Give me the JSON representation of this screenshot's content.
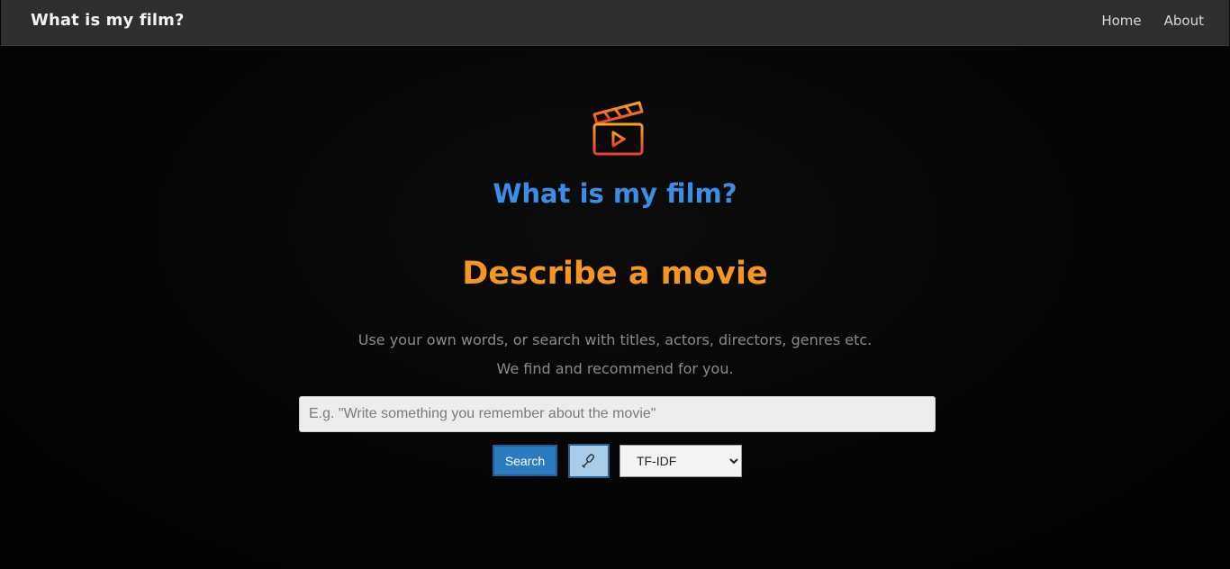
{
  "navbar": {
    "brand": "What is my film?",
    "links": [
      {
        "label": "Home"
      },
      {
        "label": "About"
      }
    ]
  },
  "hero": {
    "logo_icon": "clapperboard-play-icon",
    "title": "What is my film?",
    "heading": "Describe a movie",
    "description_line1": "Use your own words, or search with titles, actors, directors, genres etc.",
    "description_line2": "We find and recommend for you."
  },
  "search": {
    "placeholder": "E.g. \"Write something you remember about the movie\"",
    "value": "",
    "search_label": "Search",
    "mic_icon": "microphone-icon",
    "method_selected": "TF-IDF"
  },
  "colors": {
    "navbar_bg": "#2f2f2f",
    "title_blue": "#3a8ee6",
    "heading_orange": "#f5961f",
    "search_button": "#2b7bc0",
    "mic_button": "#a8cde8"
  }
}
